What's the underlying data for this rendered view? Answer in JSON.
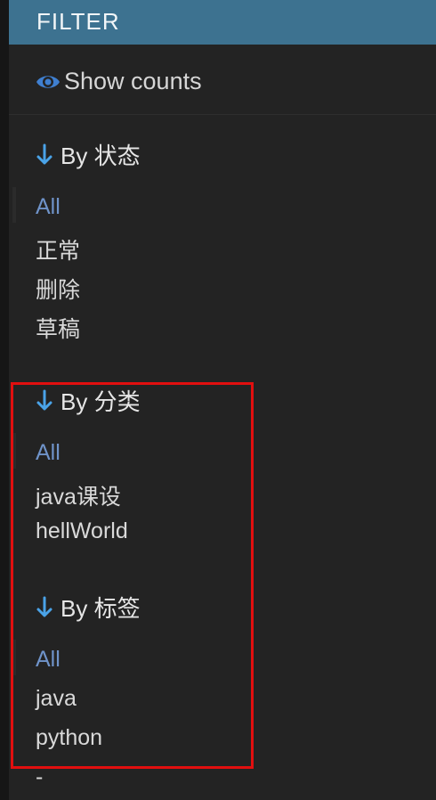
{
  "header": {
    "title": "FILTER"
  },
  "show_counts": {
    "label": "Show counts",
    "icon": "eye-icon"
  },
  "sections": [
    {
      "heading": "By 状态",
      "items": [
        "All",
        "正常",
        "删除",
        "草稿"
      ]
    },
    {
      "heading": "By 分类",
      "items": [
        "All",
        "java课设",
        "hellWorld"
      ]
    },
    {
      "heading": "By 标签",
      "items": [
        "All",
        "java",
        "python",
        "-"
      ]
    }
  ],
  "colors": {
    "header_bg": "#3d7290",
    "active_item": "#6f93c9",
    "arrow": "#4aa3e8",
    "highlight_border": "#e10f0f"
  }
}
